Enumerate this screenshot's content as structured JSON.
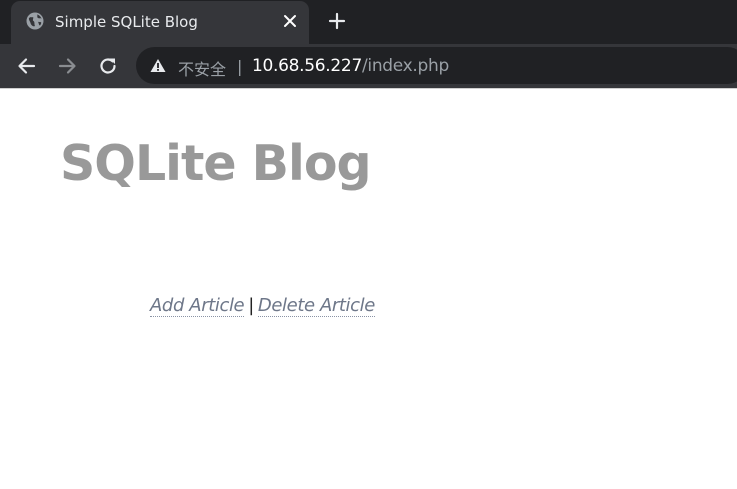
{
  "browser": {
    "tab": {
      "title": "Simple SQLite Blog",
      "icon": "globe-icon"
    },
    "toolbar": {
      "security_label": "不安全",
      "separator": "|",
      "url_host": "10.68.56.227",
      "url_path": "/index.php"
    },
    "colors": {
      "tabbar_bg": "#202124",
      "active_tab_bg": "#35363a",
      "omnibox_bg": "#202124"
    }
  },
  "page": {
    "title": "SQLite Blog",
    "links": [
      {
        "label": "Add Article"
      },
      {
        "label": "Delete Article"
      }
    ],
    "link_separator": "|",
    "colors": {
      "title": "#999999",
      "link": "#6e7789"
    }
  }
}
